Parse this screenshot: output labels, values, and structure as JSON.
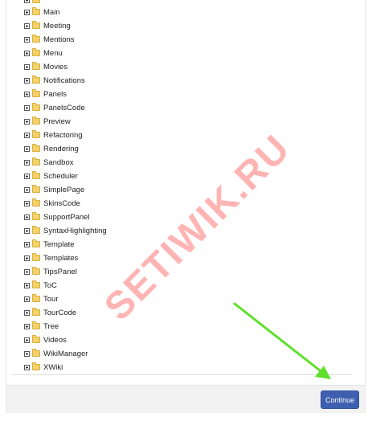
{
  "tree": {
    "items": [
      {
        "label": "Main"
      },
      {
        "label": "Meeting"
      },
      {
        "label": "Mentions"
      },
      {
        "label": "Menu"
      },
      {
        "label": "Movies"
      },
      {
        "label": "Notifications"
      },
      {
        "label": "Panels"
      },
      {
        "label": "PanelsCode"
      },
      {
        "label": "Preview"
      },
      {
        "label": "Refactoring"
      },
      {
        "label": "Rendering"
      },
      {
        "label": "Sandbox"
      },
      {
        "label": "Scheduler"
      },
      {
        "label": "SimplePage"
      },
      {
        "label": "SkinsCode"
      },
      {
        "label": "SupportPanel"
      },
      {
        "label": "SyntaxHighlighting"
      },
      {
        "label": "Template"
      },
      {
        "label": "Templates"
      },
      {
        "label": "TipsPanel"
      },
      {
        "label": "ToC"
      },
      {
        "label": "Tour"
      },
      {
        "label": "TourCode"
      },
      {
        "label": "Tree"
      },
      {
        "label": "Videos"
      },
      {
        "label": "WikiManager"
      },
      {
        "label": "XWiki"
      }
    ]
  },
  "footer": {
    "continue_label": "Continue"
  },
  "watermark": {
    "text": "SETIWIK.RU"
  },
  "colors": {
    "button": "#3f5fb0",
    "folder": "#f3d26b",
    "watermark": "#ff5b5b",
    "arrow": "#5fe02b"
  }
}
